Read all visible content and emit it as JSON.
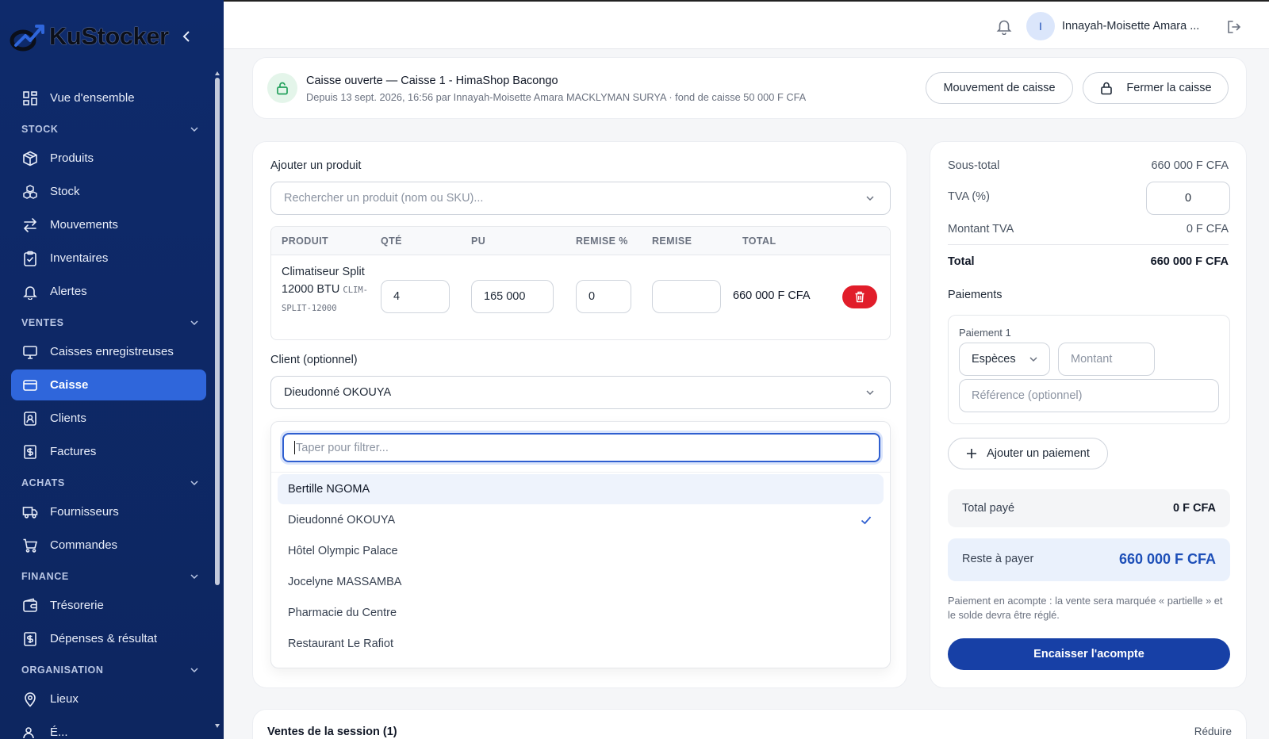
{
  "app": {
    "brand_a": "Ku",
    "brand_b": "Stocker"
  },
  "sidebar": {
    "overview": "Vue d'ensemble",
    "sections": {
      "stock": "STOCK",
      "ventes": "VENTES",
      "achats": "ACHATS",
      "finance": "FINANCE",
      "organisation": "ORGANISATION"
    },
    "items": {
      "produits": "Produits",
      "stock": "Stock",
      "mouvements": "Mouvements",
      "inventaires": "Inventaires",
      "alertes": "Alertes",
      "caisses": "Caisses enregistreuses",
      "caisse": "Caisse",
      "clients": "Clients",
      "factures": "Factures",
      "fournisseurs": "Fournisseurs",
      "commandes": "Commandes",
      "tresorerie": "Trésorerie",
      "depenses": "Dépenses & résultat",
      "lieux": "Lieux",
      "partial": "É..."
    }
  },
  "topbar": {
    "avatar_initial": "I",
    "user_name": "Innayah-Moisette Amara ..."
  },
  "session": {
    "title": "Caisse ouverte — Caisse 1 - HimaShop Bacongo",
    "subtitle": "Depuis 13 sept. 2026, 16:56 par Innayah-Moisette Amara MACKLYMAN SURYA · fond de caisse 50 000 F CFA",
    "movement_button": "Mouvement de caisse",
    "close_button": "Fermer la caisse"
  },
  "pos": {
    "add_product_label": "Ajouter un produit",
    "search_placeholder": "Rechercher un produit (nom ou SKU)...",
    "columns": [
      "PRODUIT",
      "QTÉ",
      "PU",
      "REMISE %",
      "REMISE",
      "TOTAL"
    ],
    "row": {
      "name": "Climatiseur Split 12000 BTU",
      "sku": "CLIM-SPLIT-12000",
      "qty": "4",
      "pu": "165 000",
      "remise_pct": "0",
      "remise": "",
      "total": "660 000 F CFA"
    },
    "client_label": "Client (optionnel)",
    "client_selected": "Dieudonné OKOUYA",
    "filter_placeholder": "Taper pour filtrer...",
    "client_options": [
      "Bertille NGOMA",
      "Dieudonné OKOUYA",
      "Hôtel Olympic Palace",
      "Jocelyne MASSAMBA",
      "Pharmacie du Centre",
      "Restaurant Le Rafiot"
    ]
  },
  "summary": {
    "subtotal_label": "Sous-total",
    "subtotal_value": "660 000 F CFA",
    "tva_label": "TVA (%)",
    "tva_value": "0",
    "tva_amount_label": "Montant TVA",
    "tva_amount_value": "0 F CFA",
    "total_label": "Total",
    "total_value": "660 000 F CFA",
    "payments_label": "Paiements",
    "payment1_label": "Paiement 1",
    "method": "Espèces",
    "amount_placeholder": "Montant",
    "reference_placeholder": "Référence (optionnel)",
    "add_payment": "Ajouter un paiement",
    "total_paid_label": "Total payé",
    "total_paid_value": "0 F CFA",
    "remaining_label": "Reste à payer",
    "remaining_value": "660 000 F CFA",
    "note": "Paiement en acompte : la vente sera marquée « partielle » et le solde devra être réglé.",
    "cta": "Encaisser l'acompte"
  },
  "sales": {
    "title": "Ventes de la session (1)",
    "collapse": "Réduire"
  },
  "colors": {
    "sidebar": "#0e2a6b",
    "active": "#2f66db",
    "primary": "#1740a6",
    "danger": "#e11d2a",
    "success_bg": "#e4f5ea"
  }
}
